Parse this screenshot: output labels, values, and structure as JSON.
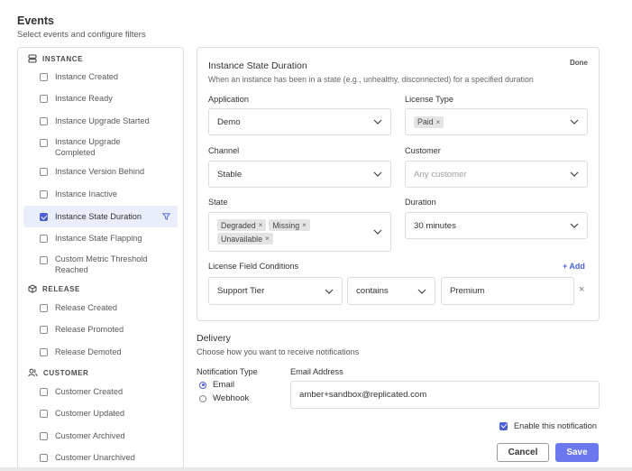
{
  "header": {
    "title": "Events",
    "subtitle": "Select events and configure filters"
  },
  "sidebar": {
    "sections": [
      {
        "label": "INSTANCE",
        "icon": "database-icon",
        "items": [
          {
            "label": "Instance Created",
            "checked": false
          },
          {
            "label": "Instance Ready",
            "checked": false
          },
          {
            "label": "Instance Upgrade Started",
            "checked": false
          },
          {
            "label": "Instance Upgrade Completed",
            "checked": false
          },
          {
            "label": "Instance Version Behind",
            "checked": false
          },
          {
            "label": "Instance Inactive",
            "checked": false
          },
          {
            "label": "Instance State Duration",
            "checked": true,
            "active": true
          },
          {
            "label": "Instance State Flapping",
            "checked": false
          },
          {
            "label": "Custom Metric Threshold Reached",
            "checked": false
          }
        ]
      },
      {
        "label": "RELEASE",
        "icon": "package-icon",
        "items": [
          {
            "label": "Release Created",
            "checked": false
          },
          {
            "label": "Release Promoted",
            "checked": false
          },
          {
            "label": "Release Demoted",
            "checked": false
          }
        ]
      },
      {
        "label": "CUSTOMER",
        "icon": "users-icon",
        "items": [
          {
            "label": "Customer Created",
            "checked": false
          },
          {
            "label": "Customer Updated",
            "checked": false
          },
          {
            "label": "Customer Archived",
            "checked": false
          },
          {
            "label": "Customer Unarchived",
            "checked": false
          }
        ]
      }
    ]
  },
  "config": {
    "title": "Instance State Duration",
    "description": "When an instance has been in a state (e.g., unhealthy, disconnected) for a specified duration",
    "done_label": "Done",
    "application": {
      "label": "Application",
      "value": "Demo"
    },
    "license_type": {
      "label": "License Type",
      "chips": [
        "Paid"
      ]
    },
    "channel": {
      "label": "Channel",
      "value": "Stable"
    },
    "customer": {
      "label": "Customer",
      "placeholder": "Any customer"
    },
    "state": {
      "label": "State",
      "chips": [
        "Degraded",
        "Missing",
        "Unavailable"
      ]
    },
    "duration": {
      "label": "Duration",
      "value": "30 minutes"
    },
    "license_conditions": {
      "label": "License Field Conditions",
      "add_label": "+ Add",
      "field": "Support Tier",
      "operator": "contains",
      "value": "Premium",
      "remove_glyph": "×"
    }
  },
  "delivery": {
    "title": "Delivery",
    "description": "Choose how you want to receive notifications",
    "type_label": "Notification Type",
    "options": [
      {
        "label": "Email",
        "selected": true
      },
      {
        "label": "Webhook",
        "selected": false
      }
    ],
    "email_label": "Email Address",
    "email_value": "amber+sandbox@replicated.com",
    "enable_label": "Enable this notification",
    "enable_checked": true,
    "cancel_label": "Cancel",
    "save_label": "Save"
  },
  "colors": {
    "accent": "#4a5fd6",
    "save_button": "#6b78ee",
    "active_row": "#eaeefc"
  }
}
